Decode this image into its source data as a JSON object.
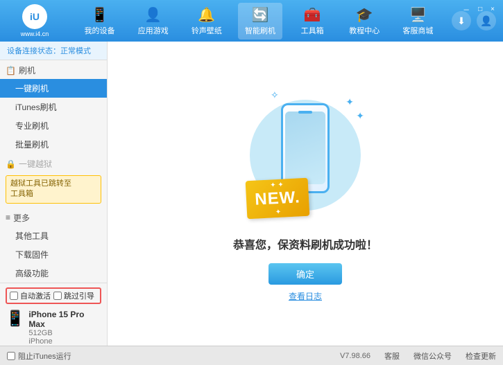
{
  "app": {
    "logo_text": "iU",
    "logo_sub": "www.i4.cn"
  },
  "nav": {
    "items": [
      {
        "id": "my-device",
        "label": "我的设备",
        "icon": "📱",
        "active": false
      },
      {
        "id": "app-games",
        "label": "应用游戏",
        "icon": "👤",
        "active": false
      },
      {
        "id": "ringtone",
        "label": "铃声壁纸",
        "icon": "🔔",
        "active": false
      },
      {
        "id": "smart-flash",
        "label": "智能刷机",
        "icon": "🔄",
        "active": true
      },
      {
        "id": "toolbox",
        "label": "工具箱",
        "icon": "🧰",
        "active": false
      },
      {
        "id": "tutorial",
        "label": "教程中心",
        "icon": "🎓",
        "active": false
      },
      {
        "id": "service",
        "label": "客服商城",
        "icon": "🖥️",
        "active": false
      }
    ]
  },
  "win_controls": {
    "minimize": "－",
    "maximize": "□",
    "close": "×"
  },
  "sidebar": {
    "status_label": "设备连接状态：",
    "status_value": "正常模式",
    "flash_section": "刷机",
    "items": [
      {
        "id": "one-click-flash",
        "label": "一键刷机",
        "active": true
      },
      {
        "id": "itunes-flash",
        "label": "iTunes刷机",
        "active": false
      },
      {
        "id": "pro-flash",
        "label": "专业刷机",
        "active": false
      },
      {
        "id": "batch-flash",
        "label": "批量刷机",
        "active": false
      }
    ],
    "one_click_jailbreak": "一键越狱",
    "jailbreak_disabled": true,
    "notice": "越狱工具已跳转至\n工具箱",
    "more_section": "更多",
    "more_items": [
      {
        "id": "other-tools",
        "label": "其他工具"
      },
      {
        "id": "download-firmware",
        "label": "下载固件"
      },
      {
        "id": "advanced",
        "label": "高级功能"
      }
    ],
    "auto_activate_label": "自动激活",
    "guide_label": "跳过引导",
    "device_name": "iPhone 15 Pro Max",
    "device_storage": "512GB",
    "device_type": "iPhone",
    "block_itunes_label": "阻止iTunes运行"
  },
  "content": {
    "new_badge": "NEW.",
    "success_message": "恭喜您，保资料刷机成功啦！",
    "confirm_button": "确定",
    "log_link": "查看日志"
  },
  "bottombar": {
    "version": "V7.98.66",
    "feedback": "客服",
    "wechat": "微信公众号",
    "check_update": "检查更新"
  }
}
